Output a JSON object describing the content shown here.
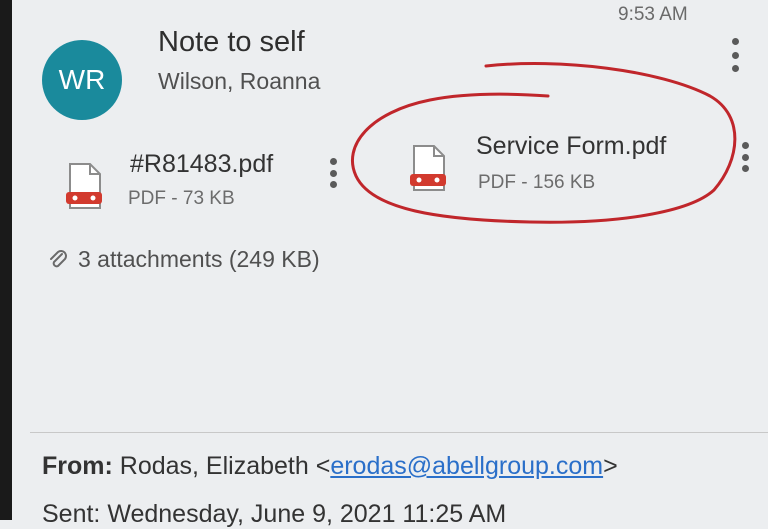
{
  "status_bar": {
    "time": "9:53 AM"
  },
  "message": {
    "avatar_initials": "WR",
    "subject": "Note to self",
    "sender": "Wilson, Roanna"
  },
  "attachments": {
    "items": [
      {
        "name": "#R81483.pdf",
        "meta": "PDF - 73 KB"
      },
      {
        "name": "Service Form.pdf",
        "meta": "PDF - 156 KB"
      }
    ],
    "summary": "3 attachments (249 KB)"
  },
  "details": {
    "from_label": "From:",
    "from_name": " Rodas, Elizabeth <",
    "from_email": "erodas@abellgroup.com",
    "from_close": ">",
    "sent_text": "Sent: Wednesday, June 9, 2021 11:25 AM"
  },
  "colors": {
    "avatar": "#1a8a9c",
    "annotation": "#c0262b",
    "link": "#2a6fc9",
    "pdf_icon": "#d23a2e"
  },
  "icons": [
    "more-vert-icon",
    "pdf-file-icon",
    "paperclip-icon"
  ]
}
